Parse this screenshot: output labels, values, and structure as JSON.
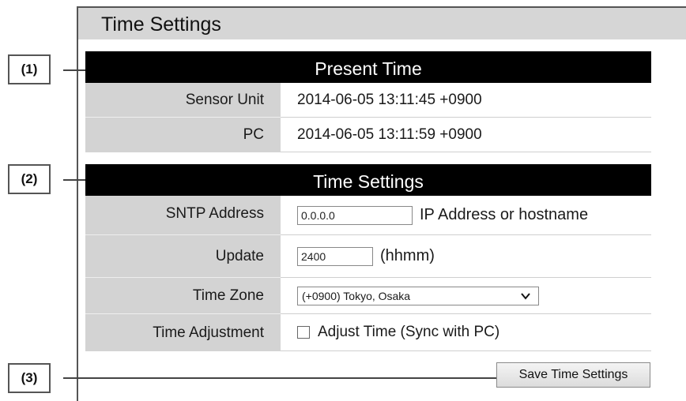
{
  "page": {
    "title": "Time Settings"
  },
  "callouts": [
    "(1)",
    "(2)",
    "(3)"
  ],
  "present_time": {
    "header": "Present Time",
    "rows": [
      {
        "label": "Sensor Unit",
        "value": "2014-06-05 13:11:45 +0900"
      },
      {
        "label": "PC",
        "value": "2014-06-05 13:11:59 +0900"
      }
    ]
  },
  "time_settings": {
    "header": "Time Settings",
    "sntp": {
      "label": "SNTP Address",
      "value": "0.0.0.0",
      "hint": "IP Address or hostname"
    },
    "update": {
      "label": "Update",
      "value": "2400",
      "hint": "(hhmm)"
    },
    "timezone": {
      "label": "Time Zone",
      "selected": "(+0900) Tokyo, Osaka"
    },
    "adjust": {
      "label": "Time Adjustment",
      "checkbox_label": "Adjust Time (Sync with PC)",
      "checked": false
    }
  },
  "actions": {
    "save_label": "Save Time Settings"
  }
}
